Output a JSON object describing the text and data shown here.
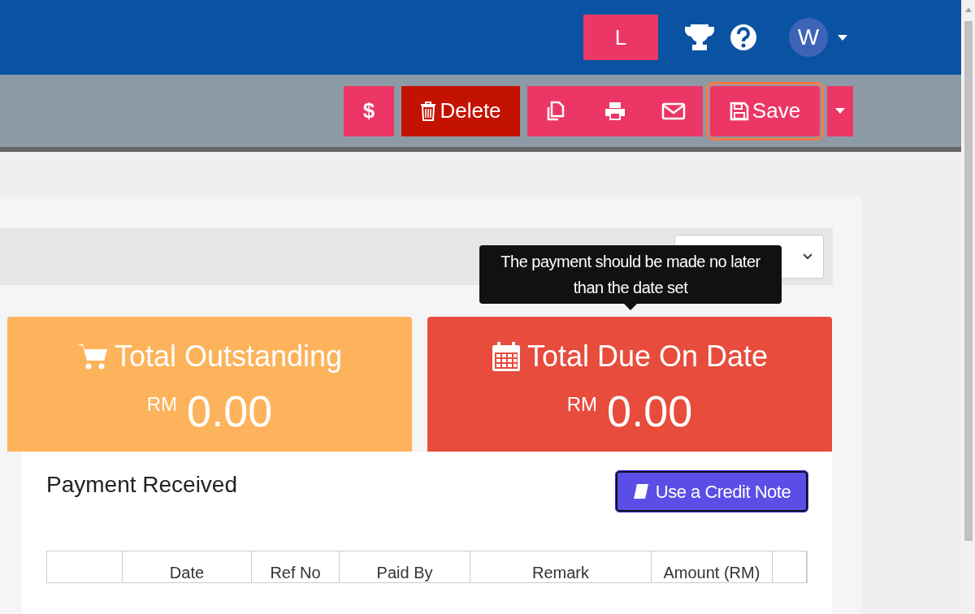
{
  "top_bar": {
    "user_button": "L",
    "avatar": "W"
  },
  "toolbar": [
    {
      "kind": "dollar",
      "label": "$",
      "highlighted": false
    },
    {
      "kind": "delete",
      "label": "Delete",
      "highlighted": false
    },
    {
      "kind": "copy",
      "highlighted": false
    },
    {
      "kind": "print",
      "highlighted": false
    },
    {
      "kind": "mail",
      "highlighted": false
    },
    {
      "kind": "save",
      "label": "Save",
      "highlighted": true
    },
    {
      "kind": "caret",
      "highlighted": false
    }
  ],
  "tooltip": "The payment should be made no later than the date set",
  "tiles": [
    {
      "kind": "cart",
      "title": "Total Outstanding",
      "currency": "RM",
      "amount": "0.00",
      "color": "#fdb35b"
    },
    {
      "kind": "calendar",
      "title": "Total Due On Date",
      "currency": "RM",
      "amount": "0.00",
      "color": "#e74c3c"
    }
  ],
  "payments": {
    "title": "Payment Received",
    "button": "Use a Credit Note",
    "columns": [
      "",
      "Date",
      "Ref No",
      "Paid By",
      "Remark",
      "Amount (RM)",
      ""
    ]
  }
}
